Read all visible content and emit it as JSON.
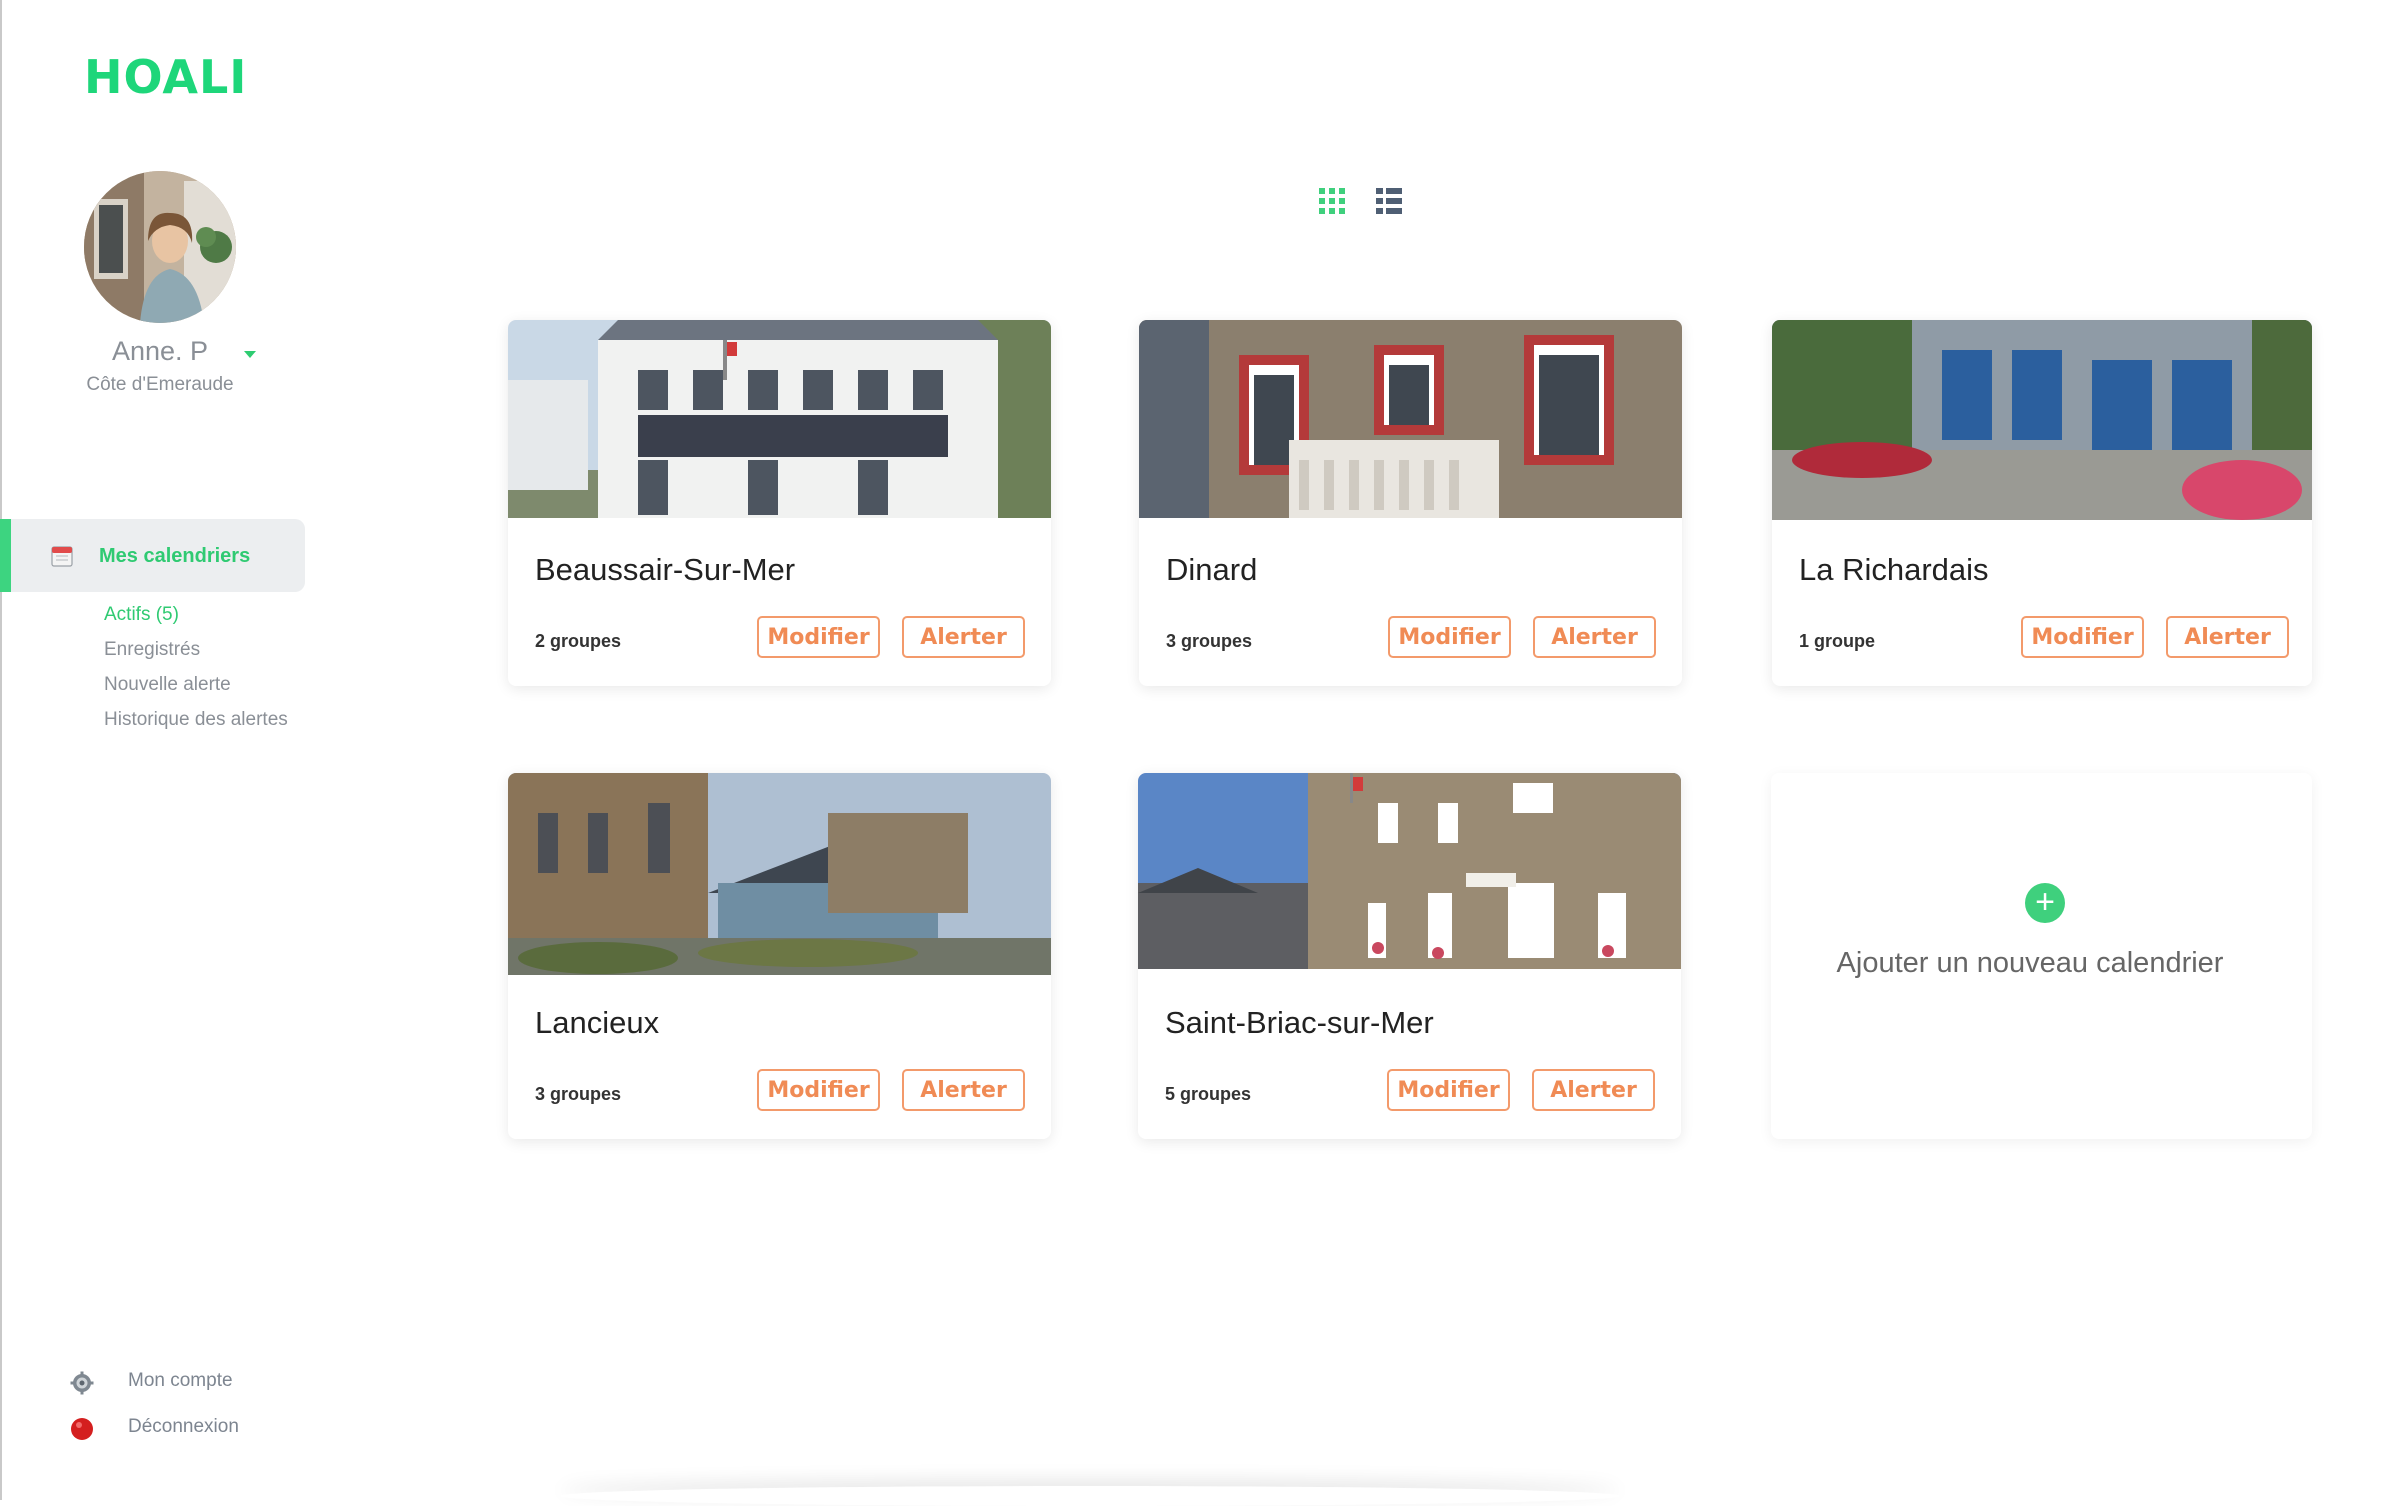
{
  "app": {
    "logo": "HOALI"
  },
  "user": {
    "name": "Anne. P",
    "region": "Côte d'Emeraude"
  },
  "nav": {
    "active_label": "Mes calendriers",
    "sub_items": [
      "Actifs (5)",
      "Enregistrés",
      "Nouvelle alerte",
      "Historique des alertes"
    ]
  },
  "footer": {
    "account_label": "Mon compte",
    "logout_label": "Déconnexion"
  },
  "view": {
    "current": "grid",
    "options": [
      "grid-icon",
      "list-icon"
    ]
  },
  "cards": [
    {
      "title": "Beaussair-Sur-Mer",
      "groups": "2 groupes",
      "modify": "Modifier",
      "alert": "Alerter"
    },
    {
      "title": "Dinard",
      "groups": "3 groupes",
      "modify": "Modifier",
      "alert": "Alerter"
    },
    {
      "title": "La Richardais",
      "groups": "1 groupe",
      "modify": "Modifier",
      "alert": "Alerter"
    },
    {
      "title": "Lancieux",
      "groups": "3 groupes",
      "modify": "Modifier",
      "alert": "Alerter"
    },
    {
      "title": "Saint-Briac-sur-Mer",
      "groups": "5 groupes",
      "modify": "Modifier",
      "alert": "Alerter"
    }
  ],
  "add_card": {
    "label": "Ajouter un nouveau calendrier"
  },
  "colors": {
    "brand_green": "#1ed67a",
    "action_orange": "#f08b55",
    "muted_text": "#8a8f96"
  }
}
